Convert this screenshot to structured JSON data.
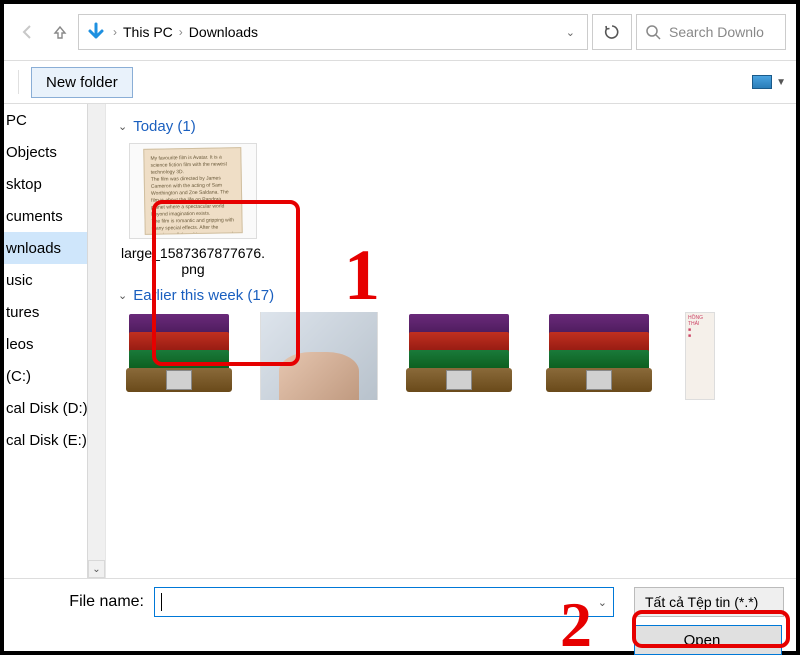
{
  "address": {
    "segments": [
      "This PC",
      "Downloads"
    ]
  },
  "search": {
    "placeholder": "Search Downlo"
  },
  "toolbar": {
    "new_folder": "New folder"
  },
  "sidebar": {
    "items": [
      {
        "label": " PC"
      },
      {
        "label": " Objects"
      },
      {
        "label": "sktop"
      },
      {
        "label": "cuments"
      },
      {
        "label": "wnloads",
        "selected": true
      },
      {
        "label": "usic"
      },
      {
        "label": "tures"
      },
      {
        "label": "leos"
      },
      {
        "label": " (C:)"
      },
      {
        "label": "cal Disk (D:)"
      },
      {
        "label": "cal Disk (E:)"
      }
    ]
  },
  "groups": {
    "today": {
      "header": "Today (1)",
      "items": [
        {
          "label": "large_1587367877676.png",
          "kind": "doc"
        }
      ]
    },
    "earlier": {
      "header": "Earlier this week (17)",
      "items": [
        {
          "kind": "rar"
        },
        {
          "kind": "photo"
        },
        {
          "kind": "rar"
        },
        {
          "kind": "rar"
        },
        {
          "kind": "flyer"
        }
      ]
    }
  },
  "footer": {
    "filename_label": "File name:",
    "filename_value": "",
    "filetype": "Tất cả Tệp tin (*.*)",
    "open": "Open"
  },
  "annotations": {
    "one": "1",
    "two": "2"
  }
}
